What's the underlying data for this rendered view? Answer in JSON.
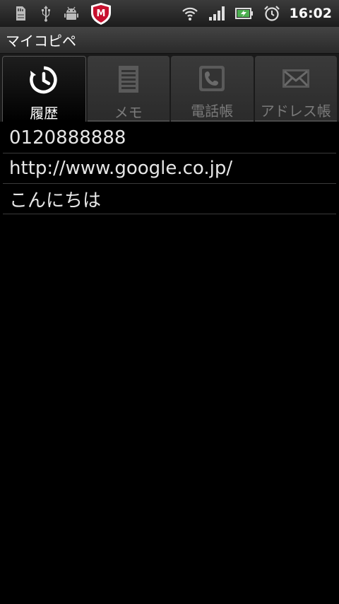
{
  "status_bar": {
    "left_icons": [
      "sd-card-icon",
      "usb-icon",
      "android-debug-icon",
      "mcafee-shield-icon"
    ],
    "right_icons": [
      "wifi-icon",
      "signal-icon",
      "battery-charging-icon",
      "alarm-clock-icon"
    ],
    "time": "16:02",
    "mcafee_letter": "M"
  },
  "app": {
    "title": "マイコピペ"
  },
  "tabs": [
    {
      "label": "履歴",
      "icon": "history-icon",
      "active": true
    },
    {
      "label": "メモ",
      "icon": "memo-icon",
      "active": false
    },
    {
      "label": "電話帳",
      "icon": "phonebook-icon",
      "active": false
    },
    {
      "label": "アドレス帳",
      "icon": "mail-icon",
      "active": false
    }
  ],
  "history": [
    {
      "text": "0120888888"
    },
    {
      "text": "http://www.google.co.jp/"
    },
    {
      "text": "こんにちは"
    }
  ],
  "colors": {
    "statusbar_bg": "#2a2a2a",
    "active_tab_text": "#ffffff",
    "inactive_tab_text": "#7a7a7a",
    "row_text": "#e6e6e6"
  }
}
